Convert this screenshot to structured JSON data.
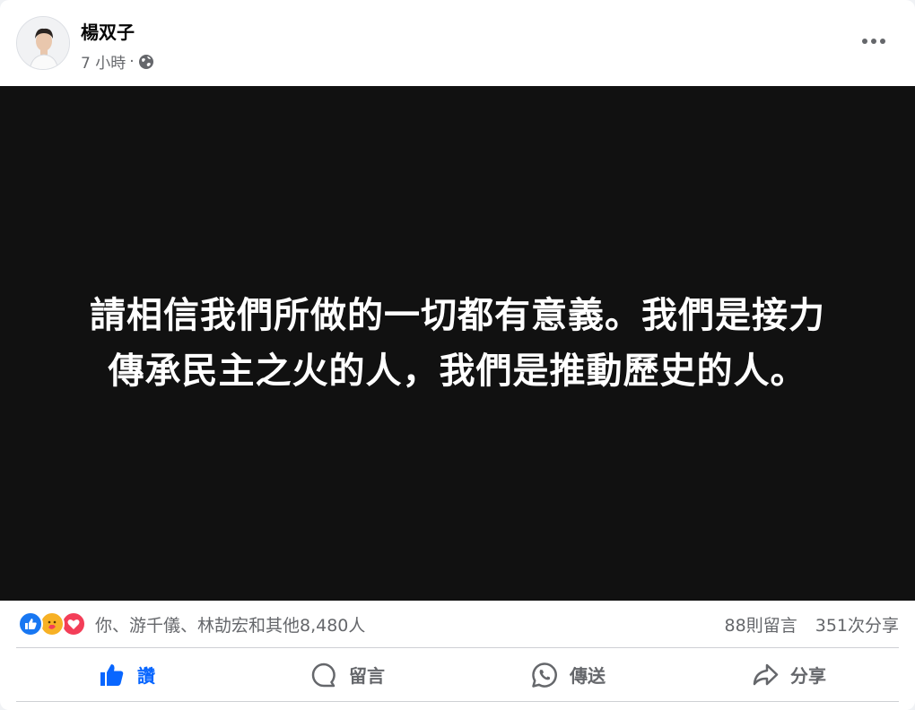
{
  "post": {
    "author": "楊双子",
    "time": "7 小時",
    "separator": "·",
    "privacy_icon": "globe-icon",
    "more_icon": "more-options-icon",
    "image_text_line1": "請相信我們所做的一切都有意義。我們是接力",
    "image_text_line2": "傳承民主之火的人，我們是推動歷史的人。"
  },
  "stats": {
    "reaction_icons": [
      "like-reaction-icon",
      "care-reaction-icon",
      "love-reaction-icon"
    ],
    "reaction_names": "你、游千儀、林劼宏和其他8,480人",
    "comments": "88則留言",
    "shares": "351次分享"
  },
  "actions": {
    "like": "讚",
    "comment": "留言",
    "send": "傳送",
    "share": "分享"
  },
  "colors": {
    "accent": "#0866ff",
    "image_background": "#111111",
    "secondary_text": "#65676b"
  }
}
